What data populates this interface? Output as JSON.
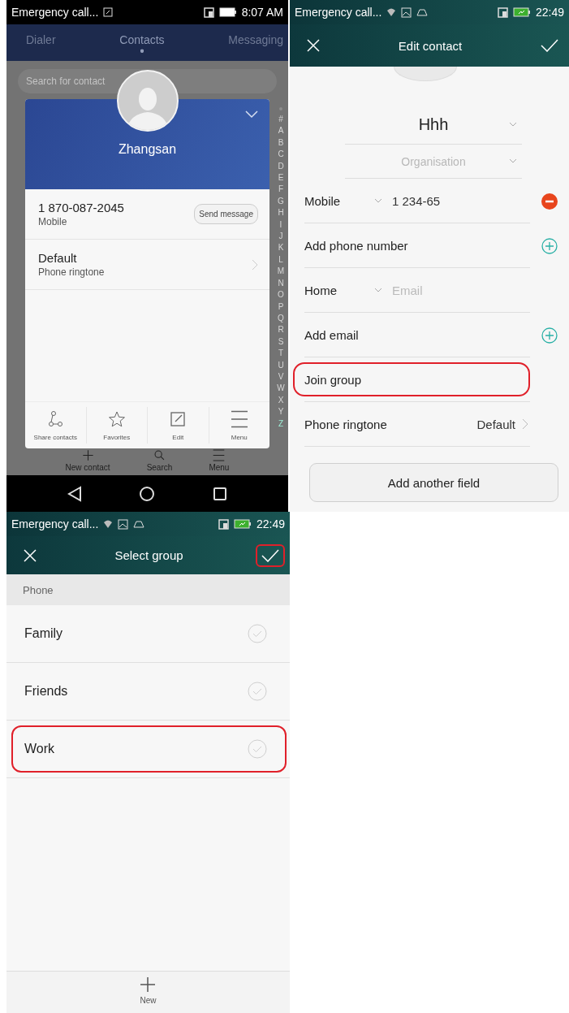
{
  "contacts_screen": {
    "status_bar": {
      "kind": "dark",
      "carrier": "Emergency call...",
      "time": "8:07 AM"
    },
    "tabs": [
      {
        "label": "Dialer",
        "selected": false
      },
      {
        "label": "Contacts",
        "selected": true
      },
      {
        "label": "Messaging",
        "selected": false
      }
    ],
    "search": {
      "placeholder": "Search for contact"
    },
    "index": [
      {
        "label": "#",
        "selected": false
      },
      {
        "label": "A",
        "selected": false
      },
      {
        "label": "B",
        "selected": false
      },
      {
        "label": "C",
        "selected": false
      },
      {
        "label": "D",
        "selected": false
      },
      {
        "label": "E",
        "selected": false
      },
      {
        "label": "F",
        "selected": false
      },
      {
        "label": "G",
        "selected": false
      },
      {
        "label": "H",
        "selected": false
      },
      {
        "label": "I",
        "selected": false
      },
      {
        "label": "J",
        "selected": false
      },
      {
        "label": "K",
        "selected": false
      },
      {
        "label": "L",
        "selected": false
      },
      {
        "label": "M",
        "selected": false
      },
      {
        "label": "N",
        "selected": false
      },
      {
        "label": "O",
        "selected": false
      },
      {
        "label": "P",
        "selected": false
      },
      {
        "label": "Q",
        "selected": false
      },
      {
        "label": "R",
        "selected": false
      },
      {
        "label": "S",
        "selected": false
      },
      {
        "label": "T",
        "selected": false
      },
      {
        "label": "U",
        "selected": false
      },
      {
        "label": "V",
        "selected": false
      },
      {
        "label": "W",
        "selected": false
      },
      {
        "label": "X",
        "selected": false
      },
      {
        "label": "Y",
        "selected": false
      },
      {
        "label": "Z",
        "selected": true
      }
    ],
    "toolbar": [
      {
        "kind": "add",
        "label": "New contact"
      },
      {
        "kind": "search",
        "label": "Search"
      },
      {
        "kind": "menu",
        "label": "Menu"
      }
    ],
    "contact_card": {
      "name": "Zhangsan",
      "phone": "1 870-087-2045",
      "phone_type": "Mobile",
      "send_button": "Send message",
      "ringtone_value": "Default",
      "ringtone_label": "Phone ringtone",
      "actions": [
        {
          "kind": "share",
          "label": "Share contacts"
        },
        {
          "kind": "favorite",
          "label": "Favorites"
        },
        {
          "kind": "edit",
          "label": "Edit"
        },
        {
          "kind": "menu",
          "label": "Menu"
        }
      ]
    }
  },
  "edit_contact_screen": {
    "status_bar": {
      "kind": "teal",
      "carrier": "Emergency call...",
      "time": "22:49"
    },
    "title": "Edit contact",
    "name_field": {
      "value": "Hhh"
    },
    "organisation_field": {
      "placeholder": "Organisation"
    },
    "rows": [
      {
        "kind": "phone",
        "type": "Mobile",
        "value": "1 234-65",
        "highlighted": false
      },
      {
        "kind": "add",
        "label": "Add phone number",
        "highlighted": false
      },
      {
        "kind": "email",
        "type": "Home",
        "placeholder": "Email",
        "highlighted": false
      },
      {
        "kind": "add",
        "label": "Add email",
        "highlighted": false
      },
      {
        "kind": "link",
        "label": "Join group",
        "highlighted": true
      },
      {
        "kind": "setting",
        "label": "Phone ringtone",
        "value": "Default",
        "highlighted": false
      }
    ],
    "add_field_button": "Add another field"
  },
  "select_group_screen": {
    "status_bar": {
      "kind": "teal",
      "carrier": "Emergency call...",
      "time": "22:49"
    },
    "title": "Select group",
    "confirm_highlighted": true,
    "section": "Phone",
    "groups": [
      {
        "label": "Family",
        "checked": false,
        "highlighted": false
      },
      {
        "label": "Friends",
        "checked": false,
        "highlighted": false
      },
      {
        "label": "Work",
        "checked": false,
        "highlighted": true
      }
    ],
    "bottom_action": "New"
  }
}
